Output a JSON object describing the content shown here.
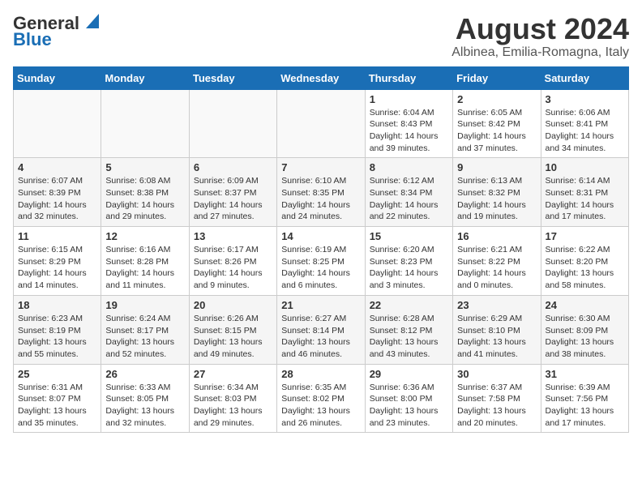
{
  "header": {
    "logo_general": "General",
    "logo_blue": "Blue",
    "month_year": "August 2024",
    "location": "Albinea, Emilia-Romagna, Italy"
  },
  "weekdays": [
    "Sunday",
    "Monday",
    "Tuesday",
    "Wednesday",
    "Thursday",
    "Friday",
    "Saturday"
  ],
  "weeks": [
    [
      {
        "day": "",
        "info": ""
      },
      {
        "day": "",
        "info": ""
      },
      {
        "day": "",
        "info": ""
      },
      {
        "day": "",
        "info": ""
      },
      {
        "day": "1",
        "info": "Sunrise: 6:04 AM\nSunset: 8:43 PM\nDaylight: 14 hours\nand 39 minutes."
      },
      {
        "day": "2",
        "info": "Sunrise: 6:05 AM\nSunset: 8:42 PM\nDaylight: 14 hours\nand 37 minutes."
      },
      {
        "day": "3",
        "info": "Sunrise: 6:06 AM\nSunset: 8:41 PM\nDaylight: 14 hours\nand 34 minutes."
      }
    ],
    [
      {
        "day": "4",
        "info": "Sunrise: 6:07 AM\nSunset: 8:39 PM\nDaylight: 14 hours\nand 32 minutes."
      },
      {
        "day": "5",
        "info": "Sunrise: 6:08 AM\nSunset: 8:38 PM\nDaylight: 14 hours\nand 29 minutes."
      },
      {
        "day": "6",
        "info": "Sunrise: 6:09 AM\nSunset: 8:37 PM\nDaylight: 14 hours\nand 27 minutes."
      },
      {
        "day": "7",
        "info": "Sunrise: 6:10 AM\nSunset: 8:35 PM\nDaylight: 14 hours\nand 24 minutes."
      },
      {
        "day": "8",
        "info": "Sunrise: 6:12 AM\nSunset: 8:34 PM\nDaylight: 14 hours\nand 22 minutes."
      },
      {
        "day": "9",
        "info": "Sunrise: 6:13 AM\nSunset: 8:32 PM\nDaylight: 14 hours\nand 19 minutes."
      },
      {
        "day": "10",
        "info": "Sunrise: 6:14 AM\nSunset: 8:31 PM\nDaylight: 14 hours\nand 17 minutes."
      }
    ],
    [
      {
        "day": "11",
        "info": "Sunrise: 6:15 AM\nSunset: 8:29 PM\nDaylight: 14 hours\nand 14 minutes."
      },
      {
        "day": "12",
        "info": "Sunrise: 6:16 AM\nSunset: 8:28 PM\nDaylight: 14 hours\nand 11 minutes."
      },
      {
        "day": "13",
        "info": "Sunrise: 6:17 AM\nSunset: 8:26 PM\nDaylight: 14 hours\nand 9 minutes."
      },
      {
        "day": "14",
        "info": "Sunrise: 6:19 AM\nSunset: 8:25 PM\nDaylight: 14 hours\nand 6 minutes."
      },
      {
        "day": "15",
        "info": "Sunrise: 6:20 AM\nSunset: 8:23 PM\nDaylight: 14 hours\nand 3 minutes."
      },
      {
        "day": "16",
        "info": "Sunrise: 6:21 AM\nSunset: 8:22 PM\nDaylight: 14 hours\nand 0 minutes."
      },
      {
        "day": "17",
        "info": "Sunrise: 6:22 AM\nSunset: 8:20 PM\nDaylight: 13 hours\nand 58 minutes."
      }
    ],
    [
      {
        "day": "18",
        "info": "Sunrise: 6:23 AM\nSunset: 8:19 PM\nDaylight: 13 hours\nand 55 minutes."
      },
      {
        "day": "19",
        "info": "Sunrise: 6:24 AM\nSunset: 8:17 PM\nDaylight: 13 hours\nand 52 minutes."
      },
      {
        "day": "20",
        "info": "Sunrise: 6:26 AM\nSunset: 8:15 PM\nDaylight: 13 hours\nand 49 minutes."
      },
      {
        "day": "21",
        "info": "Sunrise: 6:27 AM\nSunset: 8:14 PM\nDaylight: 13 hours\nand 46 minutes."
      },
      {
        "day": "22",
        "info": "Sunrise: 6:28 AM\nSunset: 8:12 PM\nDaylight: 13 hours\nand 43 minutes."
      },
      {
        "day": "23",
        "info": "Sunrise: 6:29 AM\nSunset: 8:10 PM\nDaylight: 13 hours\nand 41 minutes."
      },
      {
        "day": "24",
        "info": "Sunrise: 6:30 AM\nSunset: 8:09 PM\nDaylight: 13 hours\nand 38 minutes."
      }
    ],
    [
      {
        "day": "25",
        "info": "Sunrise: 6:31 AM\nSunset: 8:07 PM\nDaylight: 13 hours\nand 35 minutes."
      },
      {
        "day": "26",
        "info": "Sunrise: 6:33 AM\nSunset: 8:05 PM\nDaylight: 13 hours\nand 32 minutes."
      },
      {
        "day": "27",
        "info": "Sunrise: 6:34 AM\nSunset: 8:03 PM\nDaylight: 13 hours\nand 29 minutes."
      },
      {
        "day": "28",
        "info": "Sunrise: 6:35 AM\nSunset: 8:02 PM\nDaylight: 13 hours\nand 26 minutes."
      },
      {
        "day": "29",
        "info": "Sunrise: 6:36 AM\nSunset: 8:00 PM\nDaylight: 13 hours\nand 23 minutes."
      },
      {
        "day": "30",
        "info": "Sunrise: 6:37 AM\nSunset: 7:58 PM\nDaylight: 13 hours\nand 20 minutes."
      },
      {
        "day": "31",
        "info": "Sunrise: 6:39 AM\nSunset: 7:56 PM\nDaylight: 13 hours\nand 17 minutes."
      }
    ]
  ]
}
